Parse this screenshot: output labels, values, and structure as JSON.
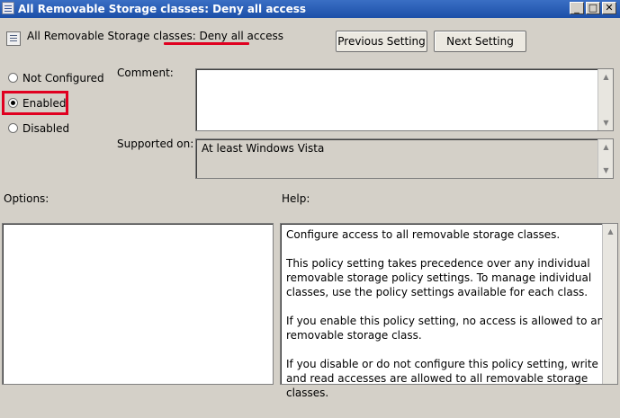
{
  "window": {
    "title": "All Removable Storage classes: Deny all access",
    "controls": {
      "minimize": "_",
      "maximize": "□",
      "close": "✕"
    }
  },
  "header": {
    "policy_prefix": "All Removable Storage classes",
    "policy_suffix": ": Deny all access",
    "previous_button": "Previous Setting",
    "next_button": "Next Setting"
  },
  "state_options": [
    {
      "label": "Not Configured",
      "selected": false
    },
    {
      "label": "Enabled",
      "selected": true
    },
    {
      "label": "Disabled",
      "selected": false
    }
  ],
  "comment": {
    "label": "Comment:",
    "value": ""
  },
  "supported": {
    "label": "Supported on:",
    "value": "At least Windows Vista"
  },
  "options": {
    "label": "Options:"
  },
  "help": {
    "label": "Help:",
    "paragraphs": [
      "Configure access to all removable storage classes.",
      "This policy setting takes precedence over any individual removable storage policy settings. To manage individual classes, use the policy settings available for each class.",
      "If you enable this policy setting, no access is allowed to any removable storage class.",
      "If you disable or do not configure this policy setting, write and read accesses are allowed to all removable storage classes."
    ]
  },
  "annotation_color": "#e00020"
}
